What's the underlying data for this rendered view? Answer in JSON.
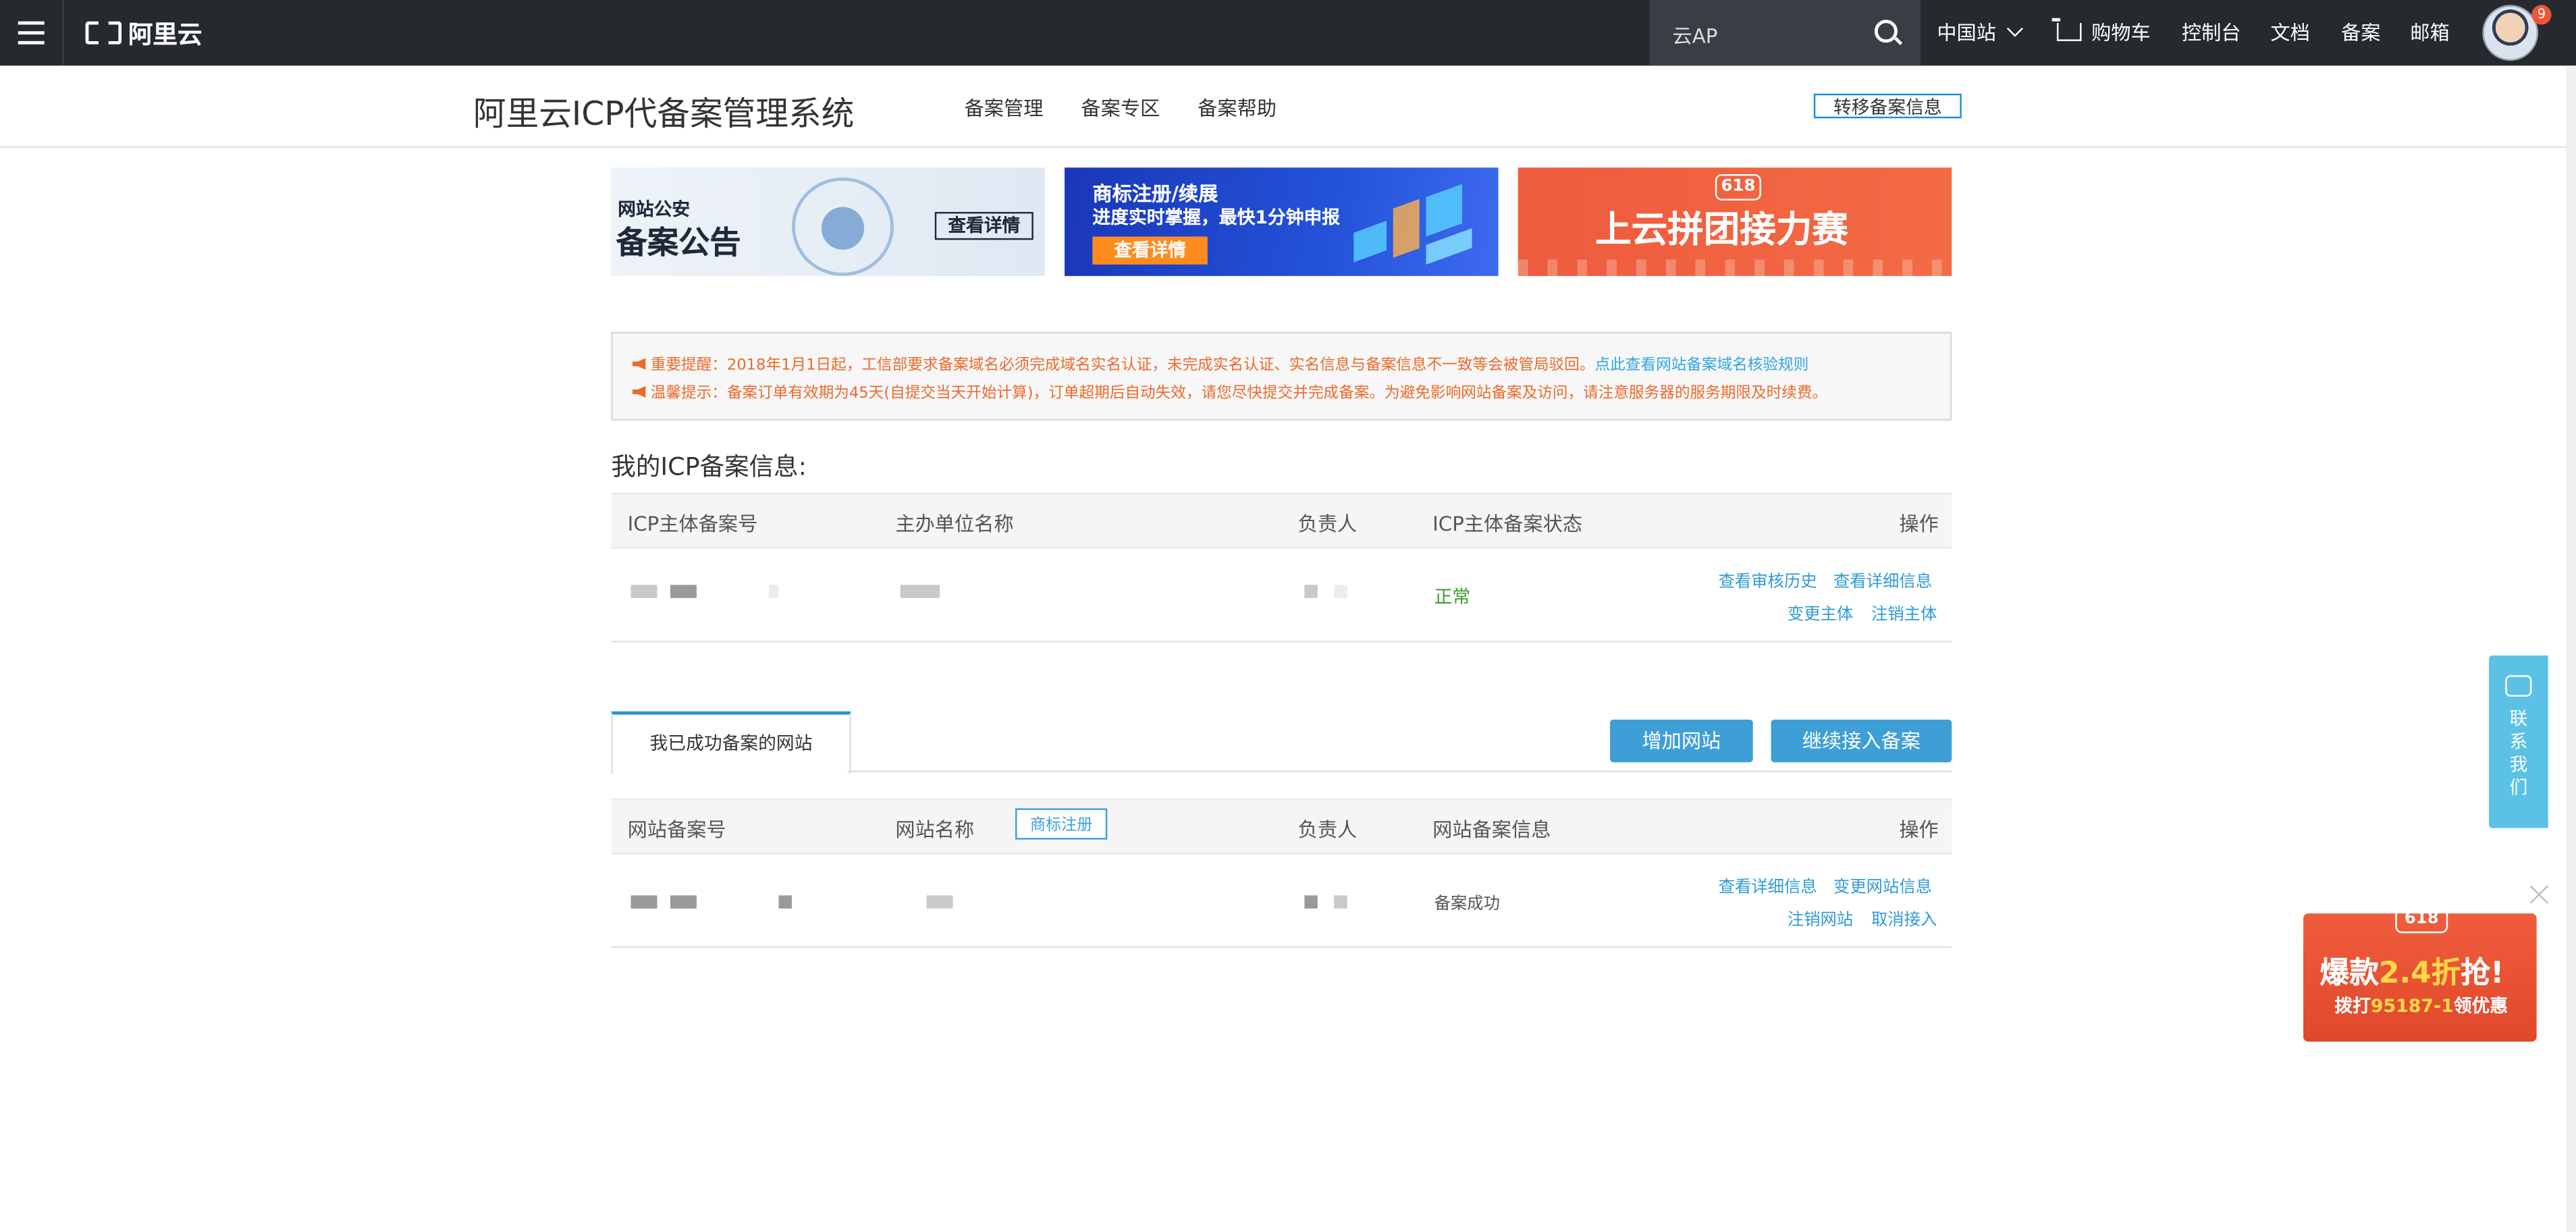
{
  "topbar": {
    "logo_text": "阿里云",
    "search_value": "云AP",
    "nav": [
      "中国站",
      "购物车",
      "控制台",
      "文档",
      "备案",
      "邮箱"
    ],
    "badge_count": "9"
  },
  "subheader": {
    "title": "阿里云ICP代备案管理系统",
    "menu": [
      "备案管理",
      "备案专区",
      "备案帮助"
    ],
    "transfer_label": "转移备案信息"
  },
  "banners": {
    "b1_small": "网站公安",
    "b1_big": "备案公告",
    "b1_btn": "查看详情",
    "b2_line1": "商标注册/续展",
    "b2_line2": "进度实时掌握，最快1分钟申报",
    "b2_btn": "查看详情",
    "b3_tag": "618",
    "b3_text": "上云拼团接力赛"
  },
  "notice": {
    "line1": "重要提醒：2018年1月1日起，工信部要求备案域名必须完成域名实名认证，未完成实名认证、实名信息与备案信息不一致等会被管局驳回。",
    "line1_link": "点此查看网站备案域名核验规则",
    "line2": "温馨提示：备案订单有效期为45天(自提交当天开始计算)，订单超期后自动失效，请您尽快提交并完成备案。为避免影响网站备案及访问，请注意服务器的服务期限及时续费。"
  },
  "icp": {
    "section_title": "我的ICP备案信息:",
    "headers": [
      "ICP主体备案号",
      "主办单位名称",
      "负责人",
      "ICP主体备案状态",
      "操作"
    ],
    "row": {
      "status": "正常",
      "ops": [
        "查看审核历史",
        "查看详细信息",
        "变更主体",
        "注销主体"
      ]
    }
  },
  "sites": {
    "tab_label": "我已成功备案的网站",
    "add_btn": "增加网站",
    "continue_btn": "继续接入备案",
    "trademark_btn": "商标注册",
    "headers": [
      "网站备案号",
      "网站名称",
      "负责人",
      "网站备案信息",
      "操作"
    ],
    "row": {
      "status": "备案成功",
      "ops": [
        "查看详细信息",
        "变更网站信息",
        "注销网站",
        "取消接入"
      ]
    }
  },
  "float": {
    "contact_text": "联系我们",
    "promo_tag": "618",
    "promo_main_pre": "爆款",
    "promo_main_hl": "2.4折",
    "promo_main_post": "抢!",
    "promo_sub_pre": "拨打",
    "promo_sub_hl": "95187-1",
    "promo_sub_post": "领优惠"
  }
}
